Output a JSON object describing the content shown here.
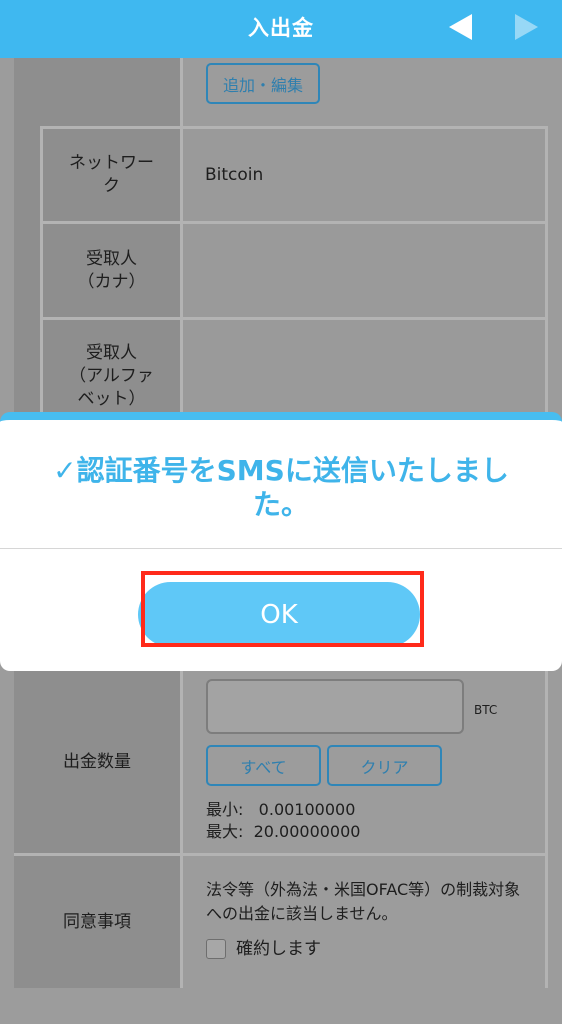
{
  "header": {
    "title": "入出金",
    "prev_icon": "triangle-left-icon",
    "next_icon": "triangle-right-icon",
    "color": "#3fb8f0"
  },
  "form": {
    "address_add_edit": "追加・編集",
    "network_label": "ネットワーク",
    "network_value": "Bitcoin",
    "recipient_kana_label": "受取人\n（カナ）",
    "recipient_alpha_label": "受取人\n（アルファ\nベット）",
    "amount_label": "出金数量",
    "amount_unit": "BTC",
    "all_button": "すべて",
    "clear_button": "クリア",
    "min_label": "最小:",
    "min_value": "0.00100000",
    "max_label": "最大:",
    "max_value": "20.00000000",
    "agreement_label": "同意事項",
    "agreement_text": "法令等（外為法・米国OFAC等）の制裁対象への出金に該当しません。",
    "confirm_checkbox_label": "確約します"
  },
  "modal": {
    "check_icon": "✓",
    "message": "認証番号をSMSに送信いたしました。",
    "ok_button": "OK",
    "accent": "#47bdf0"
  }
}
